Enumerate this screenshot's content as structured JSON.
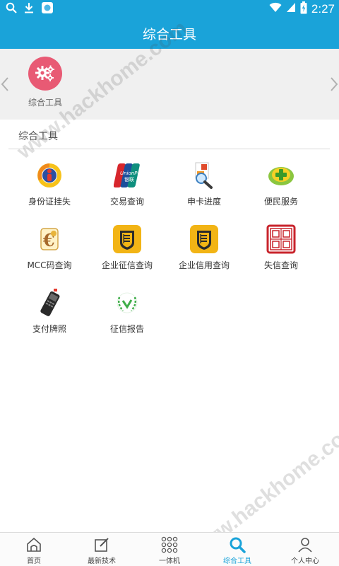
{
  "status_bar": {
    "time": "2:27"
  },
  "header": {
    "title": "综合工具"
  },
  "banner": {
    "item_label": "综合工具"
  },
  "section": {
    "title": "综合工具",
    "tools": [
      {
        "label": "身份证挂失",
        "icon": "id-card-loss-icon"
      },
      {
        "label": "交易查询",
        "icon": "unionpay-card-icon"
      },
      {
        "label": "申卡进度",
        "icon": "card-progress-search-icon"
      },
      {
        "label": "便民服务",
        "icon": "plus-service-icon"
      },
      {
        "label": "MCC码查询",
        "icon": "mcc-code-icon"
      },
      {
        "label": "企业征信查询",
        "icon": "enterprise-credit-icon"
      },
      {
        "label": "企业信用查询",
        "icon": "enterprise-trust-icon"
      },
      {
        "label": "失信查询",
        "icon": "china-law-seal-icon"
      },
      {
        "label": "支付牌照",
        "icon": "pos-terminal-icon"
      },
      {
        "label": "征信报告",
        "icon": "credit-report-laurel-icon"
      }
    ]
  },
  "watermark": {
    "text": "www.hackhome.com"
  },
  "bottom_nav": {
    "items": [
      {
        "label": "首页",
        "icon": "home-icon"
      },
      {
        "label": "最新技术",
        "icon": "edit-icon"
      },
      {
        "label": "一体机",
        "icon": "grid-dots-icon"
      },
      {
        "label": "综合工具",
        "icon": "search-icon",
        "active": true
      },
      {
        "label": "个人中心",
        "icon": "person-icon"
      }
    ]
  },
  "colors": {
    "primary": "#1aa3d9",
    "banner_icon": "#e85a74"
  }
}
